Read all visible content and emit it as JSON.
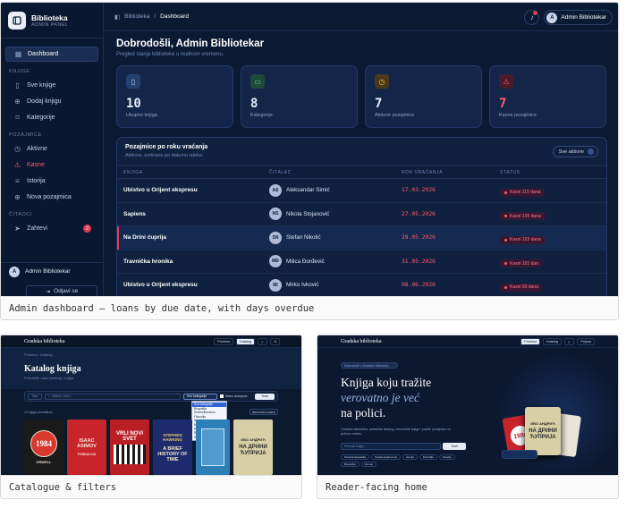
{
  "main": {
    "caption": "Admin dashboard — loans by due date, with days overdue",
    "brand": {
      "title": "Biblioteka",
      "subtitle": "ADMIN PANEL",
      "logo_letter": "B"
    },
    "sections": {
      "library": "KNJIGE",
      "loans": "POZAJMICE",
      "readers": "ČITAOCI"
    },
    "nav": {
      "dashboard": "Dashboard",
      "all_books": "Sve knjige",
      "add_book": "Dodaj knjigu",
      "categories": "Kategorije",
      "active": "Aktivne",
      "late": "Kasne",
      "history": "Istorija",
      "new_loan": "Nova pozajmica",
      "requests": "Zahtevi",
      "requests_badge": "2"
    },
    "side_user": {
      "initial": "A",
      "name": "Admin Bibliotekar"
    },
    "logout": "Odjavi se",
    "breadcrumb": {
      "root": "Biblioteka",
      "sep": "/",
      "current": "Dashboard"
    },
    "top_user": {
      "initial": "A",
      "name": "Admin Bibliotekar"
    },
    "greeting": "Dobrodošli, Admin Bibliotekar",
    "greeting_sub": "Pregled stanja biblioteke u realnom vremenu.",
    "stats": [
      {
        "value": "10",
        "label": "Ukupno knjiga",
        "color": "#e8edf7",
        "icon_bg": "#24406f",
        "icon": "▯"
      },
      {
        "value": "8",
        "label": "Kategorije",
        "color": "#e8edf7",
        "icon_bg": "#1f4a3b",
        "icon": "▭"
      },
      {
        "value": "7",
        "label": "Aktivne pozajmice",
        "color": "#e8edf7",
        "icon_bg": "#4a3a1b",
        "icon": "◷"
      },
      {
        "value": "7",
        "label": "Kasne pozajmice",
        "color": "#ff5a6e",
        "icon_bg": "#4a1b2a",
        "icon": "⚠"
      }
    ],
    "panel": {
      "title": "Pozajmice po roku vraćanja",
      "subtitle": "Aktivne, sortirane po datumu isteka.",
      "button": "Sve aktivne"
    },
    "table": {
      "headers": [
        "KNJIGA",
        "ČITALAC",
        "ROK VRAĆANJA",
        "STATUS"
      ],
      "rows": [
        {
          "book": "Ubistvo u Orijent ekspresu",
          "initials": "AS",
          "reader": "Aleksandar Simić",
          "due": "17.03.2026",
          "status": "Kasni 115 dana"
        },
        {
          "book": "Sapiens",
          "initials": "NS",
          "reader": "Nikola Stojanović",
          "due": "27.05.2026",
          "status": "Kasni 105 dana"
        },
        {
          "book": "Na Drini ćuprija",
          "initials": "SN",
          "reader": "Stefan Nikolić",
          "due": "29.05.2026",
          "status": "Kasni 103 dana"
        },
        {
          "book": "Travnička hronika",
          "initials": "MĐ",
          "reader": "Milica Đorđević",
          "due": "31.05.2026",
          "status": "Kasni 101 dan"
        },
        {
          "book": "Ubistvo u Orijent ekspresu",
          "initials": "MI",
          "reader": "Mirko Ivković",
          "due": "08.06.2026",
          "status": "Kasni 93 dana"
        }
      ]
    }
  },
  "catalogue": {
    "caption": "Catalogue & filters",
    "brand": "Gradska biblioteka",
    "nav": [
      "Početna",
      "Katalog",
      "☾",
      "A"
    ],
    "crumbs": "Početna  /  Katalog",
    "title": "Katalog knjiga",
    "subtitle": "Pretražite našu kolekciju knjiga",
    "filter_select": "Sve",
    "search_placeholder": "Naslov, autor...",
    "category_value": "Sve kategorije",
    "available_only": "Samo dostupne",
    "search_button": "Traži",
    "dropdown_options": [
      "Sve kategorije",
      "Biografija",
      "Drama/literatura",
      "Filozofija",
      "Istorija",
      "Naučna fantastika",
      "Poezija",
      "Roman",
      "Srpska književnost"
    ],
    "results": "10 knjiga pronađeno",
    "sort_button": "Abecedni (naziv)",
    "books": [
      {
        "line1": "1984",
        "line2": "ORWELL",
        "bg": "#1a1a1a",
        "fg": "#e8e2d2"
      },
      {
        "line1": "ISAAC ASIMOV",
        "line2": "FONDACIJA",
        "bg": "#c8242c",
        "fg": "#f5e9d8"
      },
      {
        "line1": "VRLI NOVI",
        "line2": "SVET",
        "bg": "#b81e24",
        "fg": "#ffffff"
      },
      {
        "line1": "STEPHEN HAWKING",
        "line2": "A BRIEF HISTORY OF TIME",
        "bg": "#1d2a6b",
        "fg": "#f0e6d0"
      },
      {
        "line1": "",
        "line2": "",
        "bg": "#2d7fb8",
        "fg": "#ffffff"
      },
      {
        "line1": "ИВО АНДРИЋ",
        "line2": "НА ДРИНИ ЋУПРИЈА",
        "bg": "#d8cfa6",
        "fg": "#2a2a2a"
      }
    ]
  },
  "home": {
    "caption": "Reader-facing home",
    "brand": "Gradska biblioteka",
    "nav": [
      "Početna",
      "Katalog",
      "☾",
      "Prijava"
    ],
    "tag": "Dobrodošli u Gradsku biblioteku",
    "h_line1": "Knjiga koju tražite",
    "h_line2": "verovatno je već",
    "h_line3": "na polici.",
    "desc": "Gradska biblioteka, pretražite katalog, rezervišite knjige i pratite pozajmice na jednom mestu.",
    "search_placeholder": "Pretraži knjige...",
    "search_button": "Traži",
    "chips": [
      "Naučna fantastika",
      "Srpska književnost",
      "Istorija",
      "Filozofija",
      "Poezija",
      "Biografija",
      "Roman"
    ],
    "hero_books": [
      {
        "line1": "ИВО АНДРИЋ",
        "line2": "НА ДРИНИ ЋУПРИЈА",
        "bg": "#d8cfa6",
        "fg": "#2a2a2a"
      },
      {
        "line1": "1984",
        "line2": "",
        "bg": "#c8242c",
        "fg": "#ffffff"
      }
    ]
  }
}
